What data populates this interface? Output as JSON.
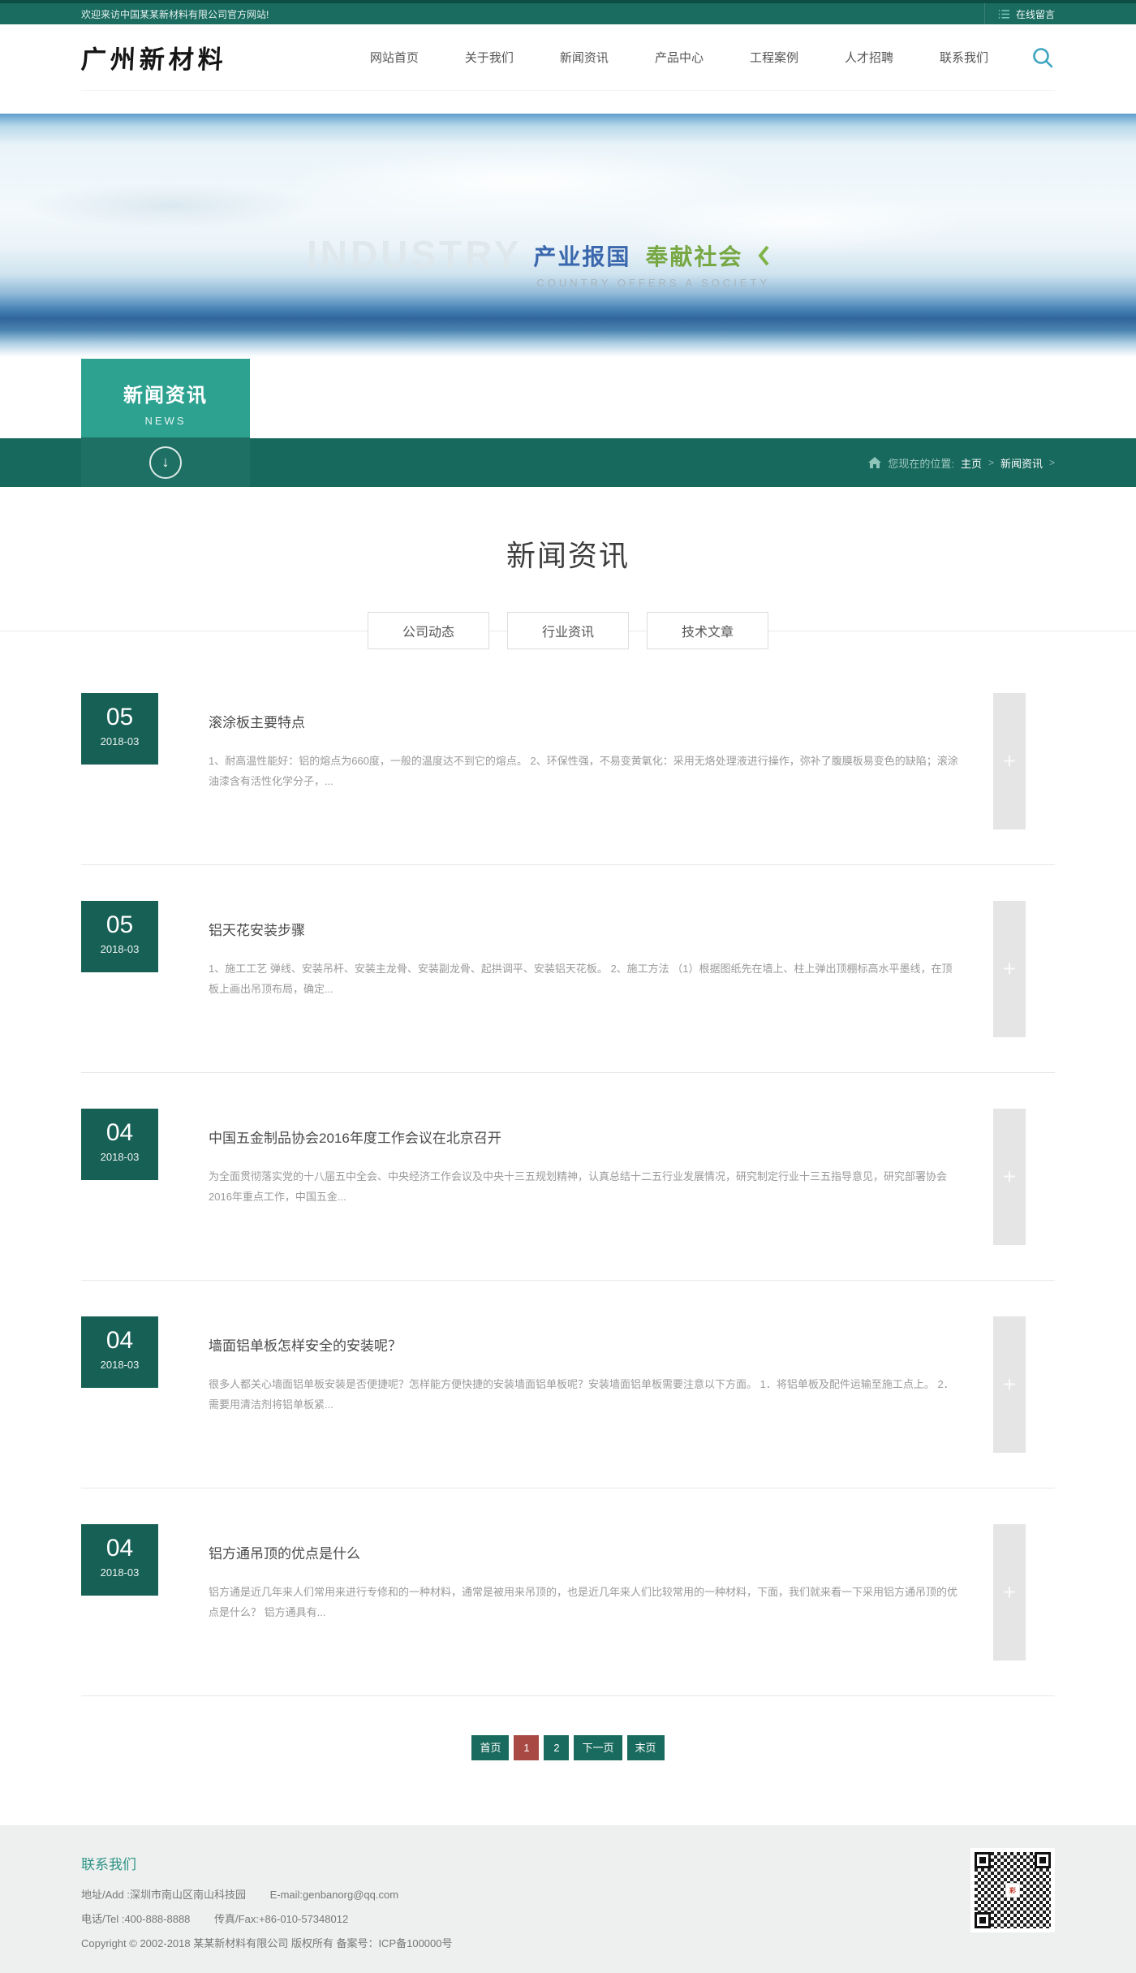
{
  "topbar": {
    "welcome": "欢迎来访中国某某新材料有限公司官方网站!",
    "message_link": "在线留言"
  },
  "header": {
    "logo": "广州新材料",
    "nav": [
      {
        "label": "网站首页"
      },
      {
        "label": "关于我们"
      },
      {
        "label": "新闻资讯"
      },
      {
        "label": "产品中心"
      },
      {
        "label": "工程案例"
      },
      {
        "label": "人才招聘"
      },
      {
        "label": "联系我们"
      }
    ]
  },
  "banner": {
    "watermark": "INDUSTRY",
    "slogan_blue": "产业报国",
    "slogan_green": "奉献社会",
    "slogan_sub": "COUNTRY OFFERS A SOCIETY"
  },
  "section_box": {
    "title_cn": "新闻资讯",
    "title_en": "NEWS",
    "down_arrow": "↓"
  },
  "breadcrumb": {
    "prefix": "您现在的位置:",
    "home": "主页",
    "current": "新闻资讯"
  },
  "page": {
    "title": "新闻资讯",
    "tabs": [
      {
        "label": "公司动态"
      },
      {
        "label": "行业资讯"
      },
      {
        "label": "技术文章"
      }
    ]
  },
  "news": {
    "plus_label": "+",
    "items": [
      {
        "day": "05",
        "month": "2018-03",
        "title": "滚涂板主要特点",
        "excerpt": "1、耐高温性能好：铝的熔点为660度，一般的温度达不到它的熔点。 2、环保性强，不易变黄氧化：采用无烙处理液进行操作，弥补了腹膜板易变色的缺陷；滚涂油漆含有活性化学分子，..."
      },
      {
        "day": "05",
        "month": "2018-03",
        "title": "铝天花安装步骤",
        "excerpt": "1、施工工艺 弹线、安装吊杆、安装主龙骨、安装副龙骨、起拱调平、安装铝天花板。 2、施工方法 （1）根据图纸先在墙上、柱上弹出顶棚标高水平墨线，在顶板上画出吊顶布局，确定..."
      },
      {
        "day": "04",
        "month": "2018-03",
        "title": "中国五金制品协会2016年度工作会议在北京召开",
        "excerpt": "为全面贯彻落实党的十八届五中全会、中央经济工作会议及中央十三五规划精神，认真总结十二五行业发展情况，研究制定行业十三五指导意见，研究部署协会2016年重点工作，中国五金..."
      },
      {
        "day": "04",
        "month": "2018-03",
        "title": "墙面铝单板怎样安全的安装呢？",
        "excerpt": "很多人都关心墙面铝单板安装是否便捷呢？怎样能方便快捷的安装墙面铝单板呢？安装墙面铝单板需要注意以下方面。 1．将铝单板及配件运输至施工点上。 2．需要用清洁剂将铝单板紧..."
      },
      {
        "day": "04",
        "month": "2018-03",
        "title": "铝方通吊顶的优点是什么",
        "excerpt": "铝方通是近几年来人们常用来进行专修和的一种材料，通常是被用来吊顶的，也是近几年来人们比较常用的一种材料，下面，我们就来看一下采用铝方通吊顶的优点是什么？ 铝方通具有..."
      }
    ]
  },
  "pagination": {
    "first": "首页",
    "page1": "1",
    "page2": "2",
    "next": "下一页",
    "last": "末页"
  },
  "footer": {
    "heading": "联系我们",
    "address": "地址/Add :深圳市南山区南山科技园",
    "email": "E-mail:genbanorg@qq.com",
    "phone": "电话/Tel :400-888-8888",
    "fax": "传真/Fax:+86-010-57348012",
    "copyright": "Copyright © 2002-2018 某某新材料有限公司 版权所有  备案号：ICP备100000号",
    "qr_center_label": "彩"
  },
  "colors": {
    "accent_teal": "#1a6b5f",
    "band_teal": "#17685d",
    "box_teal": "#2da291",
    "active_red": "#a84a43",
    "footer_bg": "#edf0ef"
  }
}
